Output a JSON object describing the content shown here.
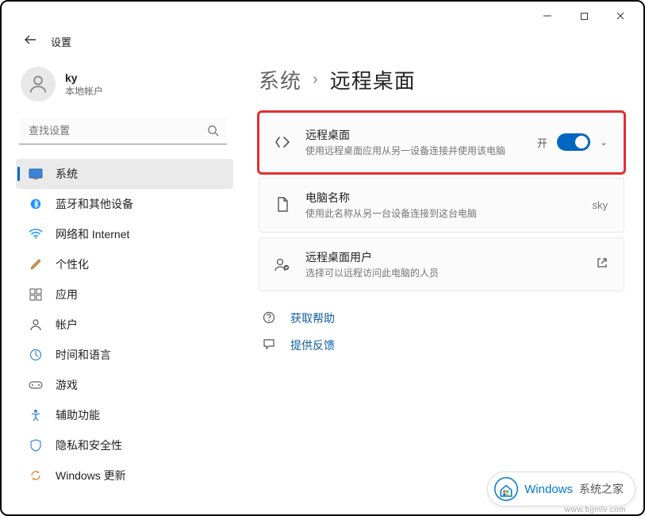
{
  "window": {
    "title": "设置"
  },
  "user": {
    "name": "ky",
    "subtitle": "本地帐户"
  },
  "search": {
    "placeholder": "查找设置"
  },
  "nav": {
    "items": [
      {
        "label": "系统"
      },
      {
        "label": "蓝牙和其他设备"
      },
      {
        "label": "网络和 Internet"
      },
      {
        "label": "个性化"
      },
      {
        "label": "应用"
      },
      {
        "label": "帐户"
      },
      {
        "label": "时间和语言"
      },
      {
        "label": "游戏"
      },
      {
        "label": "辅助功能"
      },
      {
        "label": "隐私和安全性"
      },
      {
        "label": "Windows 更新"
      }
    ]
  },
  "breadcrumb": {
    "parent": "系统",
    "current": "远程桌面"
  },
  "cards": {
    "remote": {
      "title": "远程桌面",
      "desc": "使用远程桌面应用从另一设备连接并使用该电脑",
      "state_label": "开"
    },
    "computer": {
      "title": "电脑名称",
      "desc": "使用此名称从另一台设备连接到这台电脑",
      "value": "sky"
    },
    "users": {
      "title": "远程桌面用户",
      "desc": "选择可以远程访问此电脑的人员"
    }
  },
  "links": {
    "help": "获取帮助",
    "feedback": "提供反馈"
  },
  "watermark": {
    "brand": "Windows",
    "tagline": "系统之家",
    "url": "www.bjjmlv.com"
  }
}
